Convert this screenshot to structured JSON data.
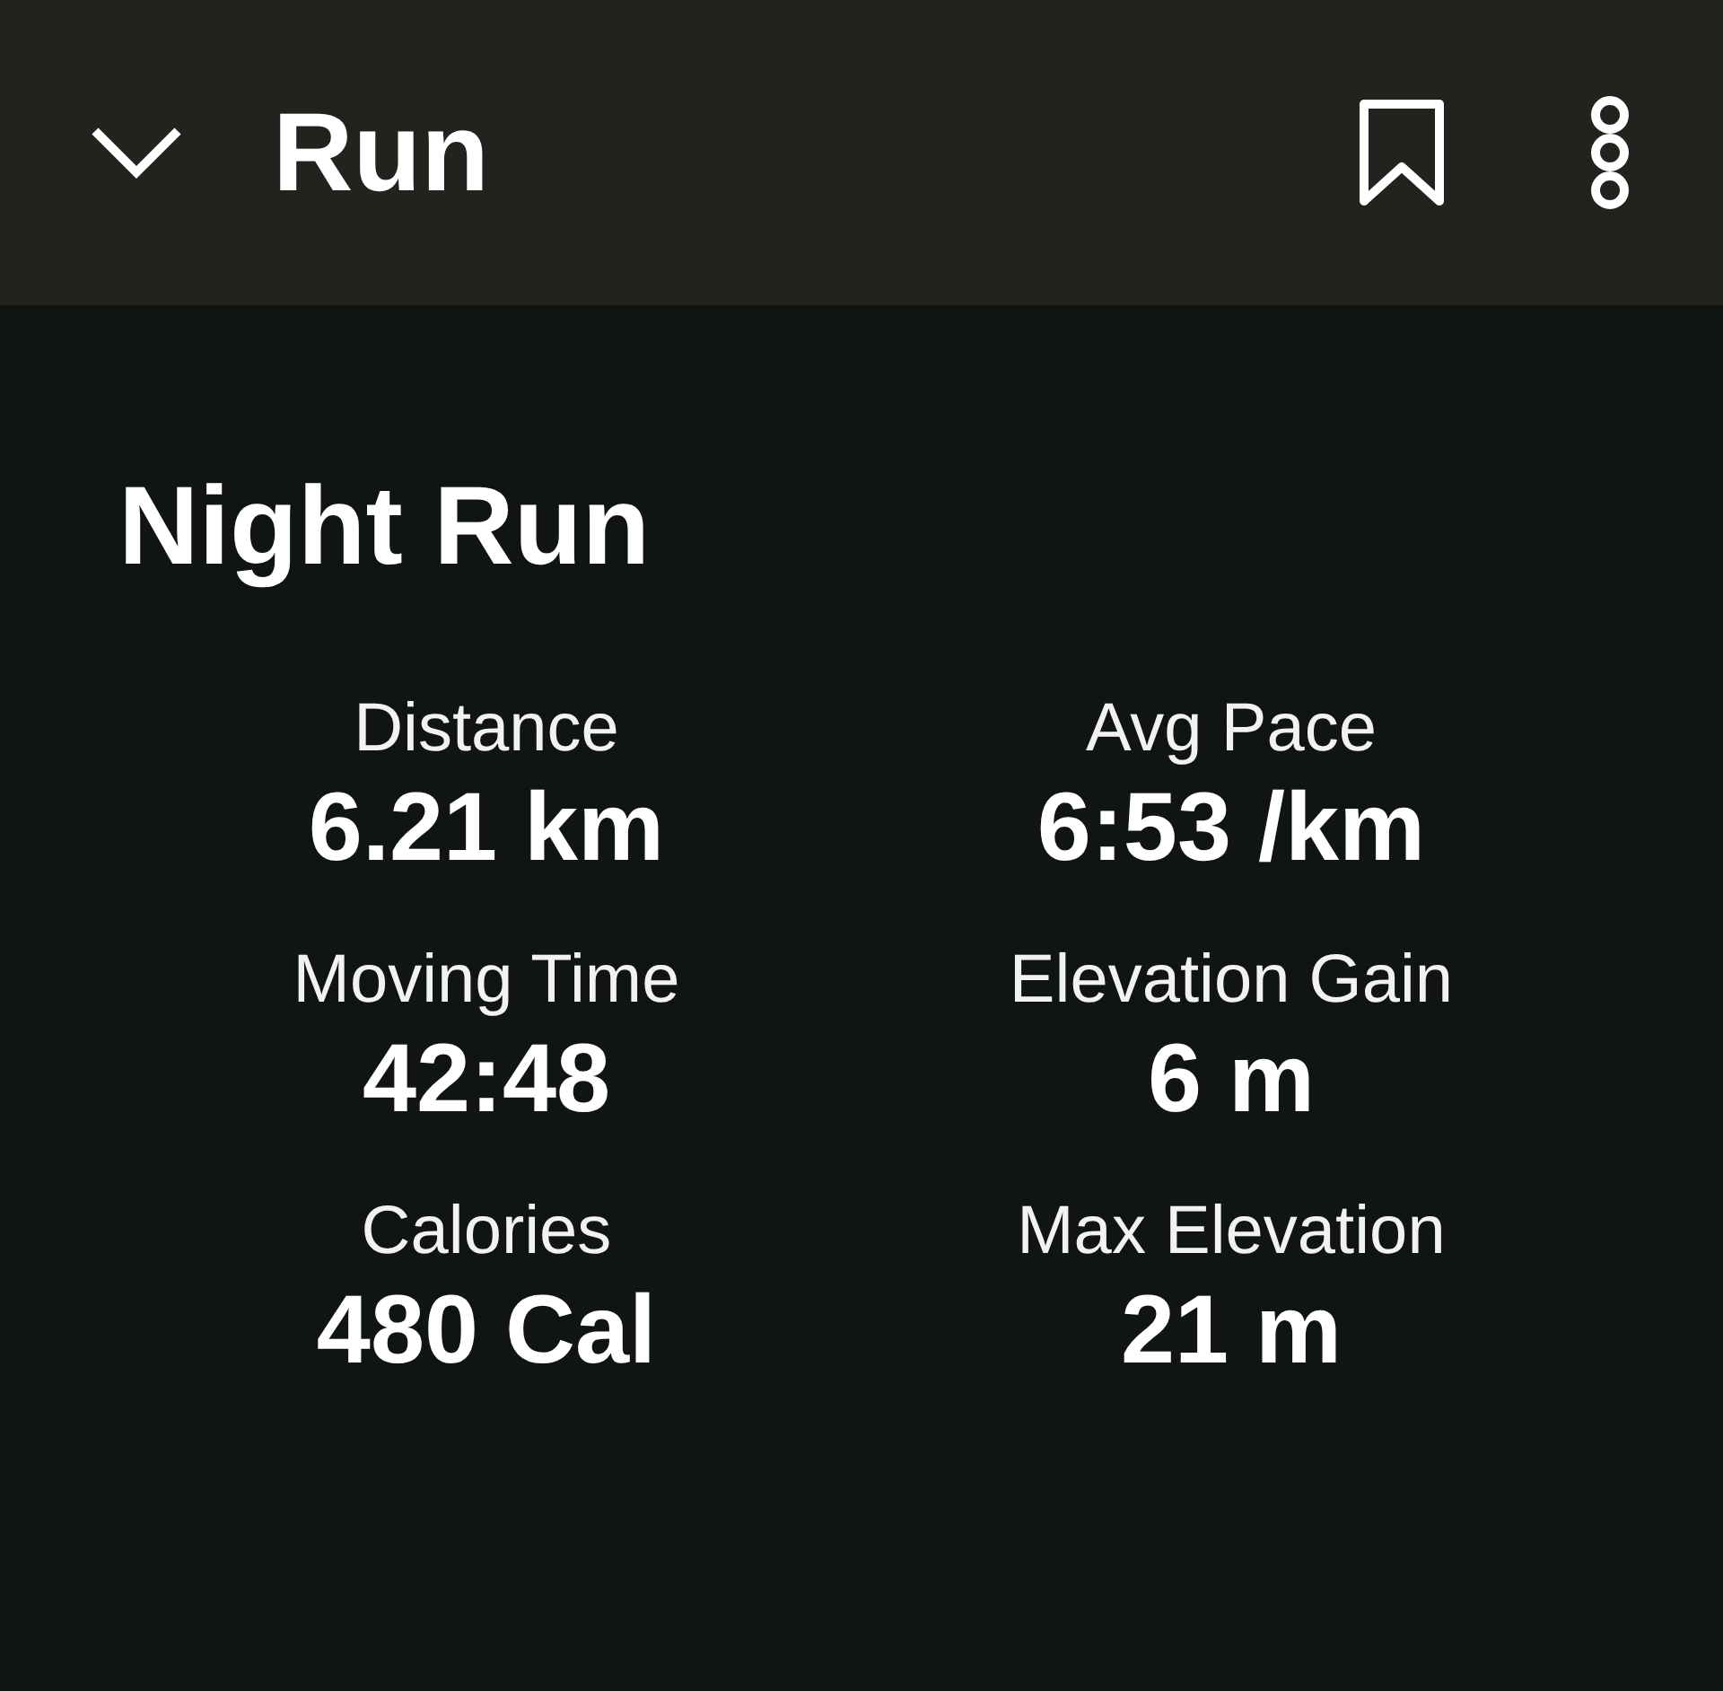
{
  "header": {
    "title": "Run"
  },
  "activity": {
    "title": "Night Run"
  },
  "stats": [
    {
      "label": "Distance",
      "value": "6.21 km"
    },
    {
      "label": "Avg Pace",
      "value": "6:53 /km"
    },
    {
      "label": "Moving Time",
      "value": "42:48"
    },
    {
      "label": "Elevation Gain",
      "value": "6 m"
    },
    {
      "label": "Calories",
      "value": "480 Cal"
    },
    {
      "label": "Max Elevation",
      "value": "21 m"
    }
  ]
}
